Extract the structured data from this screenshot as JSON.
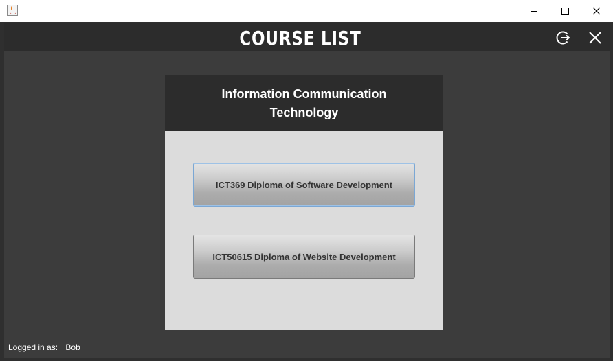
{
  "window": {
    "app_icon": "java-cup-icon",
    "controls": [
      "minimize-icon",
      "maximize-icon",
      "close-icon"
    ]
  },
  "header": {
    "title": "COURSE LIST",
    "logout_icon": "logout-icon",
    "close_icon": "close-icon"
  },
  "panel": {
    "title": "Information Communication Technology",
    "courses": [
      {
        "label": "ICT369 Diploma of Software Development"
      },
      {
        "label": "ICT50615 Diploma of Website Development"
      }
    ]
  },
  "status": {
    "label": "Logged in as:",
    "user": "Bob"
  },
  "colors": {
    "frame_background": "#3c3c3c",
    "header_background": "#2c2c2c",
    "panel_background": "#dcdcdc",
    "focus_border": "#7ba7d4"
  }
}
